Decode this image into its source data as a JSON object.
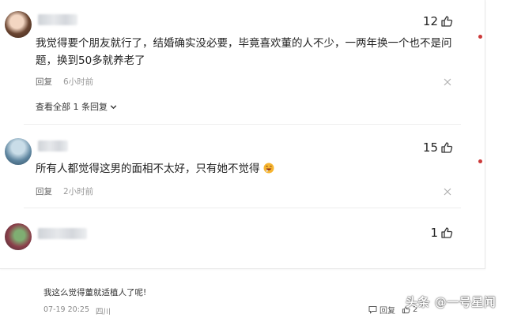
{
  "comments": [
    {
      "likes": "12",
      "text": "我觉得要个朋友就行了，结婚确实没必要，毕竟喜欢董的人不少，一两年换一个也不是问题，换到50多就养老了",
      "reply_label": "回复",
      "time": "6小时前",
      "view_all": "查看全部 1 条回复"
    },
    {
      "likes": "15",
      "text": "所有人都觉得这男的面相不太好，只有她不觉得",
      "reply_label": "回复",
      "time": "2小时前"
    },
    {
      "likes": "1"
    }
  ],
  "reply": {
    "text": "我这么觉得董就适植人了呢!",
    "date": "07-19 20:25",
    "location": "四川",
    "reply_label": "回复",
    "like_count": "2"
  },
  "watermark": "头条 @一号星闻",
  "colors": {
    "accent_dot": "#cc3a3a",
    "text": "#222222",
    "muted": "#999999"
  }
}
